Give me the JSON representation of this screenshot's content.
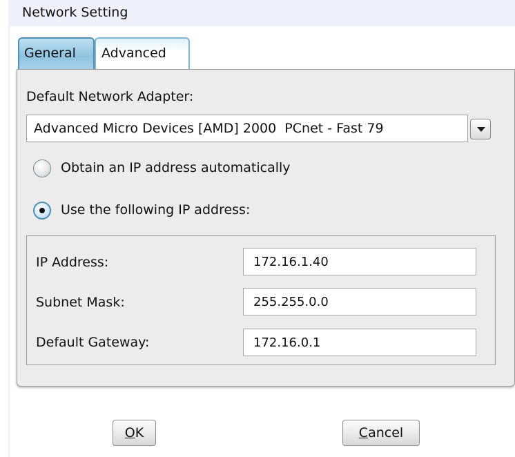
{
  "window": {
    "title": "Network Setting"
  },
  "tabs": [
    {
      "label": "General",
      "active": true
    },
    {
      "label": "Advanced",
      "active": false
    }
  ],
  "adapter": {
    "label": "Default Network Adapter:",
    "selected": "Advanced Micro Devices [AMD] 2000  PCnet - Fast 79"
  },
  "ip_mode": {
    "auto_label": "Obtain an IP address automatically",
    "auto_selected": false,
    "manual_label": "Use the following IP address:",
    "manual_selected": true
  },
  "ip_fields": {
    "ip_label": "IP Address:",
    "ip_value": "172.16.1.40",
    "subnet_label": "Subnet Mask:",
    "subnet_value": "255.255.0.0",
    "gateway_label": "Default Gateway:",
    "gateway_value": "172.16.0.1"
  },
  "buttons": {
    "ok_label": "OK",
    "ok_mnemonic": "O",
    "cancel_label": "Cancel",
    "cancel_mnemonic": "C"
  },
  "colors": {
    "titlebar": "#eef0fa",
    "tab_active": "#8ec3e0",
    "panel": "#ececec",
    "radio_accent": "#4e90b8"
  }
}
